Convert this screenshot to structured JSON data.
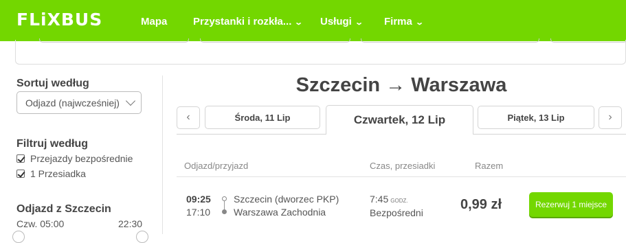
{
  "header": {
    "logo": "FLiXBUS",
    "nav": [
      {
        "label": "Mapa"
      },
      {
        "label": "Przystanki i rozkła..."
      },
      {
        "label": "Usługi"
      },
      {
        "label": "Firma"
      }
    ]
  },
  "sidebar": {
    "sort_title": "Sortuj według",
    "sort_selected": "Odjazd (najwcześniej)",
    "filter_title": "Filtruj według",
    "filters": [
      {
        "label": "Przejazdy bezpośrednie",
        "checked": true
      },
      {
        "label": "1 Przesiadka",
        "checked": true
      }
    ],
    "departure_title": "Odjazd z Szczecin",
    "departure_from": "Czw. 05:00",
    "departure_to": "22:30"
  },
  "main": {
    "route_title": "Szczecin → Warszawa",
    "prev_arrow": "‹",
    "next_arrow": "›",
    "days": [
      {
        "label": "Środa, 11 Lip"
      },
      {
        "label": "Czwartek, 12 Lip"
      },
      {
        "label": "Piątek, 13 Lip"
      }
    ],
    "columns": {
      "departure": "Odjazd/przyjazd",
      "duration": "Czas, przesiadki",
      "total": "Razem"
    },
    "trip": {
      "departure_time": "09:25",
      "arrival_time": "17:10",
      "departure_station": "Szczecin (dworzec PKP)",
      "arrival_station": "Warszawa Zachodnia",
      "duration": "7:45",
      "duration_unit": "GODZ.",
      "transfers": "Bezpośredni",
      "price": "0,99 zł",
      "book_label": "Rezerwuj 1 miejsce"
    }
  },
  "colors": {
    "brand_green": "#73d700",
    "text": "#444444"
  }
}
